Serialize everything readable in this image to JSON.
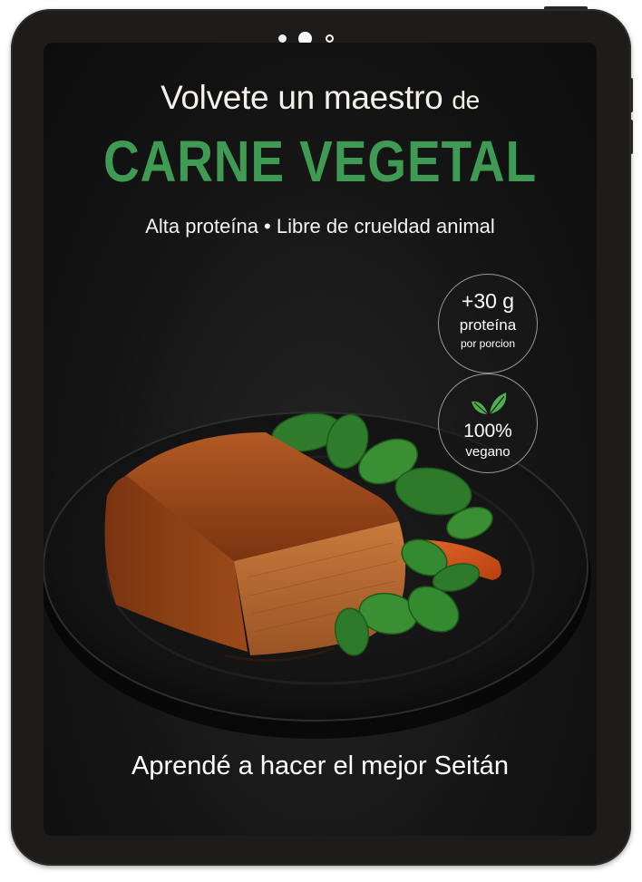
{
  "cover": {
    "headline_main": "Volvete un maestro",
    "headline_tail": "de",
    "title": "CARNE VEGETAL",
    "subtitle": "Alta proteína • Libre de crueldad animal",
    "cta": "Aprendé a hacer el mejor Seitán"
  },
  "badges": {
    "protein": {
      "amount": "+30 g",
      "label": "proteína",
      "detail": "por porcion"
    },
    "vegan": {
      "icon": "leaves-icon",
      "percent": "100%",
      "label": "vegano"
    }
  },
  "colors": {
    "accent_green": "#3f9a54",
    "frame": "#1d1c1a",
    "screen_bg": "#151515",
    "text_light": "#f4f1e9"
  },
  "image": {
    "subject": "plate-with-seitan-and-greens-image"
  }
}
